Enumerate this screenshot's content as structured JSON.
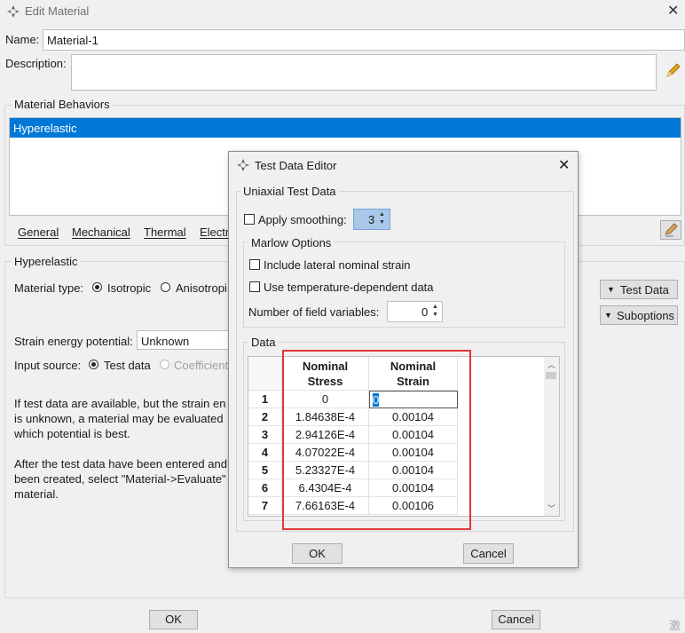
{
  "window": {
    "title": "Edit Material"
  },
  "name": {
    "label": "Name:",
    "value": "Material-1"
  },
  "description": {
    "label": "Description:",
    "value": ""
  },
  "behaviors": {
    "title": "Material Behaviors",
    "items": [
      "Hyperelastic"
    ]
  },
  "menu": [
    "General",
    "Mechanical",
    "Thermal",
    "Electr"
  ],
  "hyperelastic": {
    "title": "Hyperelastic",
    "material_type_label": "Material type:",
    "isotropic": "Isotropic",
    "anisotropic": "Anisotropi",
    "strain_energy_label": "Strain energy potential:",
    "strain_energy_value": "Unknown",
    "input_source_label": "Input source:",
    "test_data": "Test data",
    "coefficients": "Coefficient",
    "info1": [
      "If test data are available, but the strain en",
      "is unknown, a material may be evaluated",
      "which potential is best."
    ],
    "info2": [
      "After the test data have been entered and",
      "been created, select \"Material->Evaluate\"",
      "material."
    ],
    "test_data_btn": "Test Data",
    "suboptions_btn": "Suboptions"
  },
  "footer": {
    "ok": "OK",
    "cancel": "Cancel"
  },
  "watermark": "激",
  "dialog": {
    "title": "Test Data Editor",
    "uniaxial_title": "Uniaxial Test Data",
    "apply_smoothing": "Apply smoothing:",
    "smoothing_value": "3",
    "marlow_title": "Marlow Options",
    "include_lateral": "Include lateral nominal strain",
    "use_temp": "Use temperature-dependent data",
    "num_field_label": "Number of field variables:",
    "num_field_value": "0",
    "data_title": "Data",
    "table": {
      "headers": [
        [
          "Nominal",
          "Stress"
        ],
        [
          "Nominal",
          "Strain"
        ]
      ],
      "rows": [
        [
          "1",
          "0",
          "0"
        ],
        [
          "2",
          "1.84638E-4",
          "0.00104"
        ],
        [
          "3",
          "2.94126E-4",
          "0.00104"
        ],
        [
          "4",
          "4.07022E-4",
          "0.00104"
        ],
        [
          "5",
          "5.23327E-4",
          "0.00104"
        ],
        [
          "6",
          "6.4304E-4",
          "0.00104"
        ],
        [
          "7",
          "7.66163E-4",
          "0.00106"
        ]
      ]
    },
    "ok": "OK",
    "cancel": "Cancel",
    "highlight_color": "#e0383a"
  }
}
